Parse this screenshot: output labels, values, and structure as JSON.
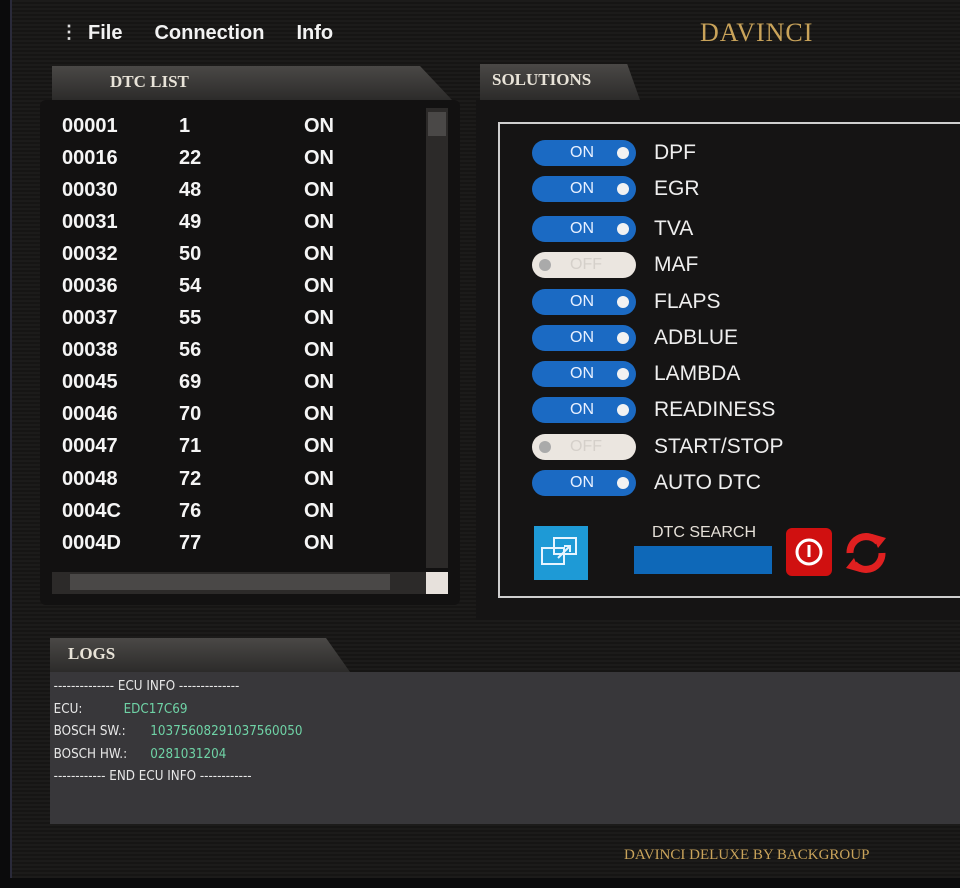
{
  "menu": {
    "items": [
      "File",
      "Connection",
      "Info"
    ]
  },
  "brand": "DAVINCI",
  "dtc": {
    "title": "DTC LIST",
    "rows": [
      [
        "00001",
        "1",
        "ON"
      ],
      [
        "00016",
        "22",
        "ON"
      ],
      [
        "00030",
        "48",
        "ON"
      ],
      [
        "00031",
        "49",
        "ON"
      ],
      [
        "00032",
        "50",
        "ON"
      ],
      [
        "00036",
        "54",
        "ON"
      ],
      [
        "00037",
        "55",
        "ON"
      ],
      [
        "00038",
        "56",
        "ON"
      ],
      [
        "00045",
        "69",
        "ON"
      ],
      [
        "00046",
        "70",
        "ON"
      ],
      [
        "00047",
        "71",
        "ON"
      ],
      [
        "00048",
        "72",
        "ON"
      ],
      [
        "0004C",
        "76",
        "ON"
      ],
      [
        "0004D",
        "77",
        "ON"
      ]
    ]
  },
  "solutions": {
    "title": "SOLUTIONS",
    "items": [
      {
        "label": "DPF",
        "state": "ON"
      },
      {
        "label": "EGR",
        "state": "ON"
      },
      {
        "label": "TVA",
        "state": "ON"
      },
      {
        "label": "MAF",
        "state": "OFF"
      },
      {
        "label": "FLAPS",
        "state": "ON"
      },
      {
        "label": "ADBLUE",
        "state": "ON"
      },
      {
        "label": "LAMBDA",
        "state": "ON"
      },
      {
        "label": "READINESS",
        "state": "ON"
      },
      {
        "label": "START/STOP",
        "state": "OFF"
      },
      {
        "label": "AUTO DTC",
        "state": "ON"
      }
    ],
    "search_label": "DTC SEARCH",
    "search_value": ""
  },
  "logs": {
    "title": "LOGS",
    "header": "-------------- ECU INFO --------------",
    "ecu_label": "ECU:",
    "ecu": "EDC17C69",
    "sw_label": "BOSCH SW.:",
    "sw": "1037560829103756005​0",
    "hw_label": "BOSCH HW.:",
    "hw": "0281031204",
    "footer": "------------ END ECU INFO ------------"
  },
  "footer": "DAVINCI DELUXE BY BACKGROUP"
}
